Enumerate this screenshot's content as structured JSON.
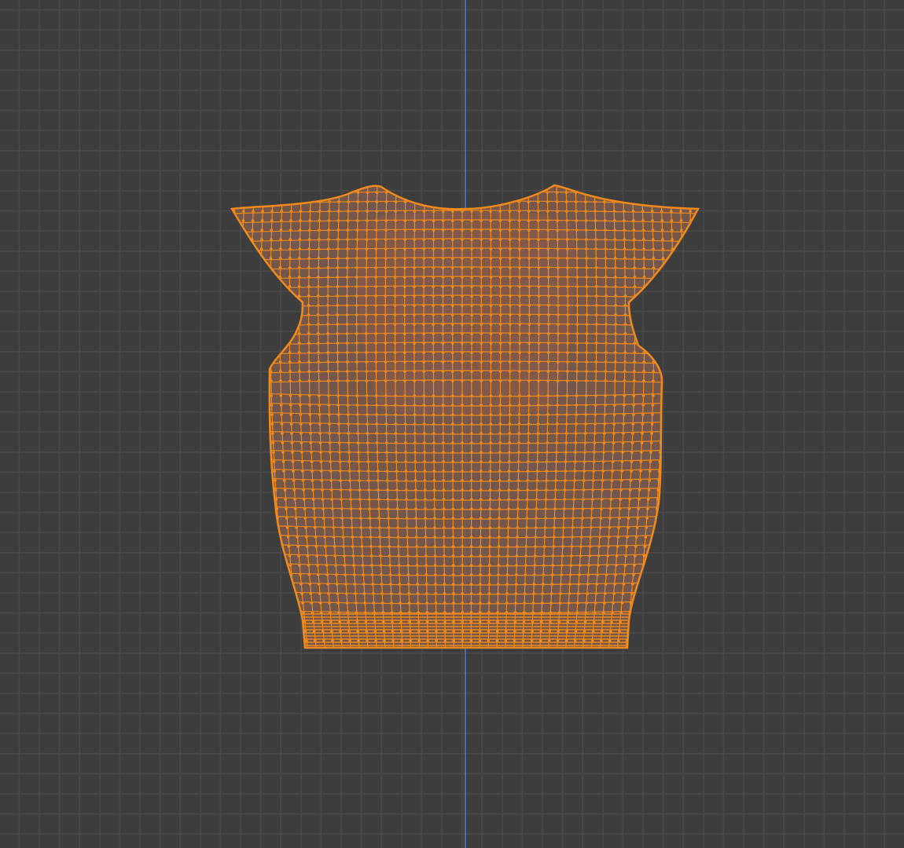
{
  "viewport": {
    "background_color": "#3d3d3d",
    "grid_color": "#4a4a4a",
    "axis_color": "#4a7fd0",
    "mesh_edge_color": "#f08a1a",
    "mesh_face_color": "#7a5a4e"
  }
}
